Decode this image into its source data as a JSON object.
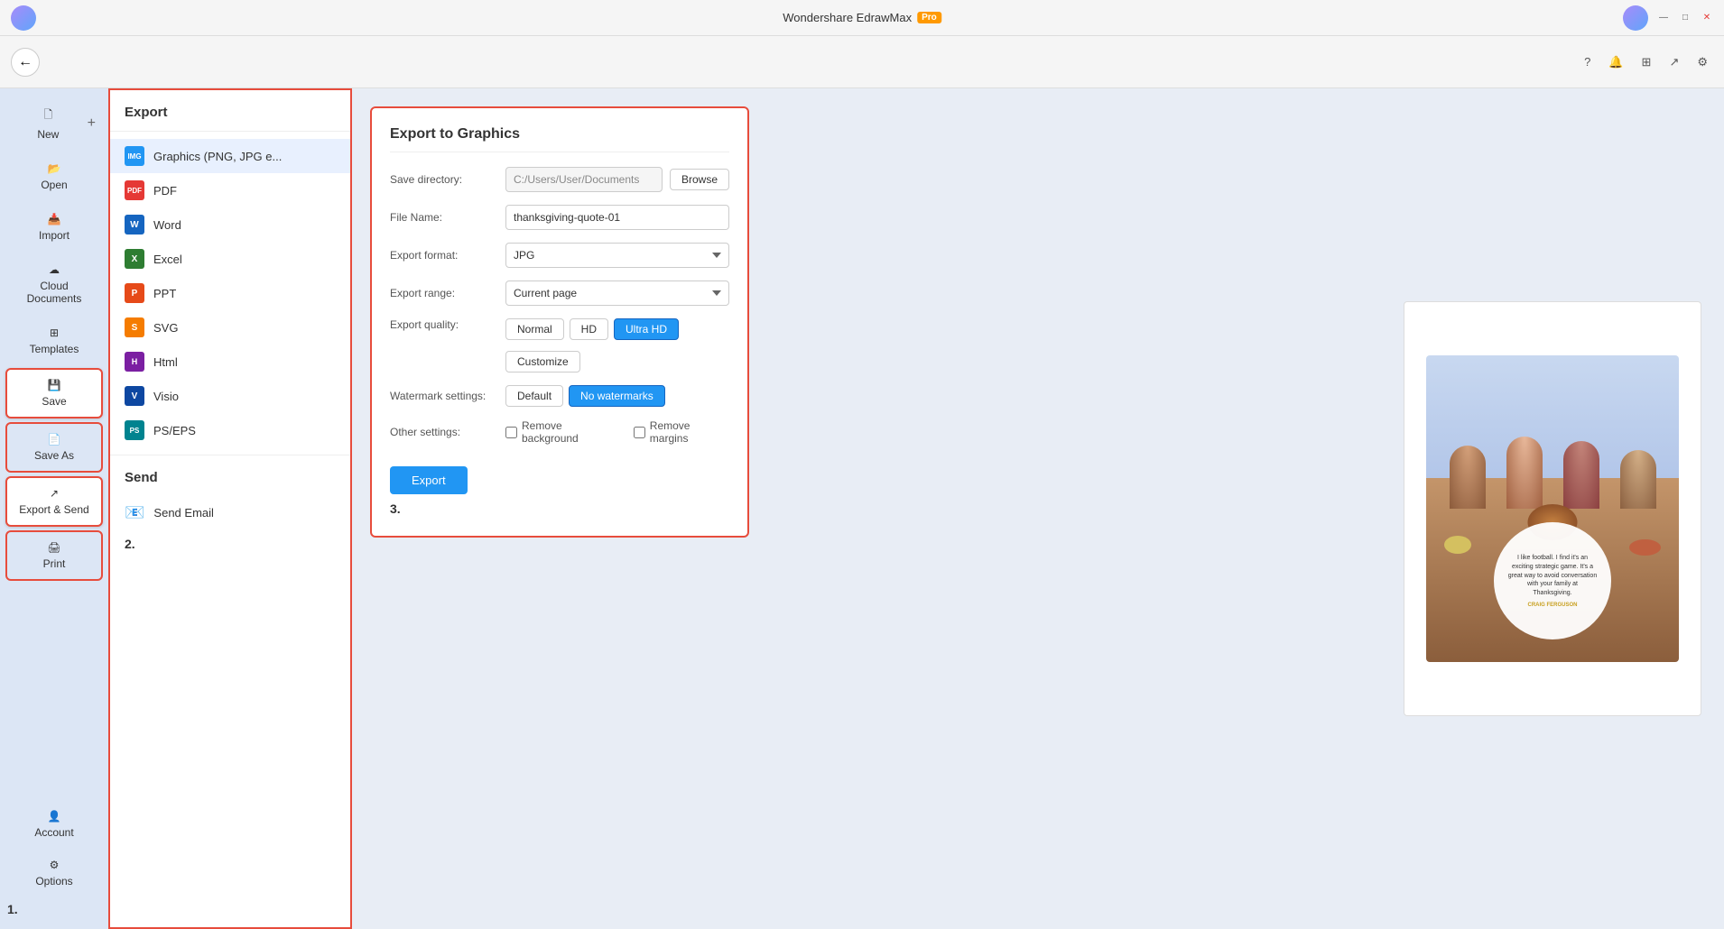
{
  "titlebar": {
    "app_name": "Wondershare EdrawMax",
    "pro_label": "Pro",
    "minimize": "—",
    "maximize": "□",
    "close": "✕"
  },
  "toolbar": {
    "help_icon": "?",
    "notification_icon": "🔔",
    "grid_icon": "⊞",
    "share_icon": "↗",
    "settings_icon": "⚙"
  },
  "sidebar": {
    "new_label": "New",
    "open_label": "Open",
    "import_label": "Import",
    "cloud_label": "Cloud Documents",
    "templates_label": "Templates",
    "save_label": "Save",
    "save_as_label": "Save As",
    "export_label": "Export & Send",
    "print_label": "Print",
    "account_label": "Account",
    "options_label": "Options"
  },
  "export_panel": {
    "title": "Export",
    "items": [
      {
        "label": "Graphics (PNG, JPG e...",
        "icon_text": "IMG",
        "icon_class": "icon-png"
      },
      {
        "label": "PDF",
        "icon_text": "PDF",
        "icon_class": "icon-pdf"
      },
      {
        "label": "Word",
        "icon_text": "W",
        "icon_class": "icon-word"
      },
      {
        "label": "Excel",
        "icon_text": "X",
        "icon_class": "icon-excel"
      },
      {
        "label": "PPT",
        "icon_text": "P",
        "icon_class": "icon-ppt"
      },
      {
        "label": "SVG",
        "icon_text": "S",
        "icon_class": "icon-svg"
      },
      {
        "label": "Html",
        "icon_text": "H",
        "icon_class": "icon-html"
      },
      {
        "label": "Visio",
        "icon_text": "V",
        "icon_class": "icon-visio"
      },
      {
        "label": "PS/EPS",
        "icon_text": "PS",
        "icon_class": "icon-pseps"
      }
    ],
    "send_title": "Send",
    "send_items": [
      {
        "label": "Send Email",
        "icon": "📧"
      }
    ]
  },
  "dialog": {
    "title": "Export to Graphics",
    "save_directory_label": "Save directory:",
    "save_directory_value": "C:/Users/User/Documents",
    "browse_label": "Browse",
    "file_name_label": "File Name:",
    "file_name_value": "thanksgiving-quote-01",
    "export_format_label": "Export format:",
    "export_format_value": "JPG",
    "export_range_label": "Export range:",
    "export_range_value": "Current page",
    "export_quality_label": "Export quality:",
    "quality_normal": "Normal",
    "quality_hd": "HD",
    "quality_ultrahd": "Ultra HD",
    "customize_label": "Customize",
    "watermark_label": "Watermark settings:",
    "watermark_default": "Default",
    "watermark_none": "No watermarks",
    "other_settings_label": "Other settings:",
    "remove_bg_label": "Remove background",
    "remove_margins_label": "Remove margins",
    "export_btn": "Export"
  },
  "numbering": {
    "n1": "1.",
    "n2": "2.",
    "n3": "3."
  },
  "quote": {
    "text": "I like football. I find it's an exciting strategic game. It's a great way to avoid conversation with your family at Thanksgiving.",
    "author": "CRAIG FERGUSON"
  }
}
